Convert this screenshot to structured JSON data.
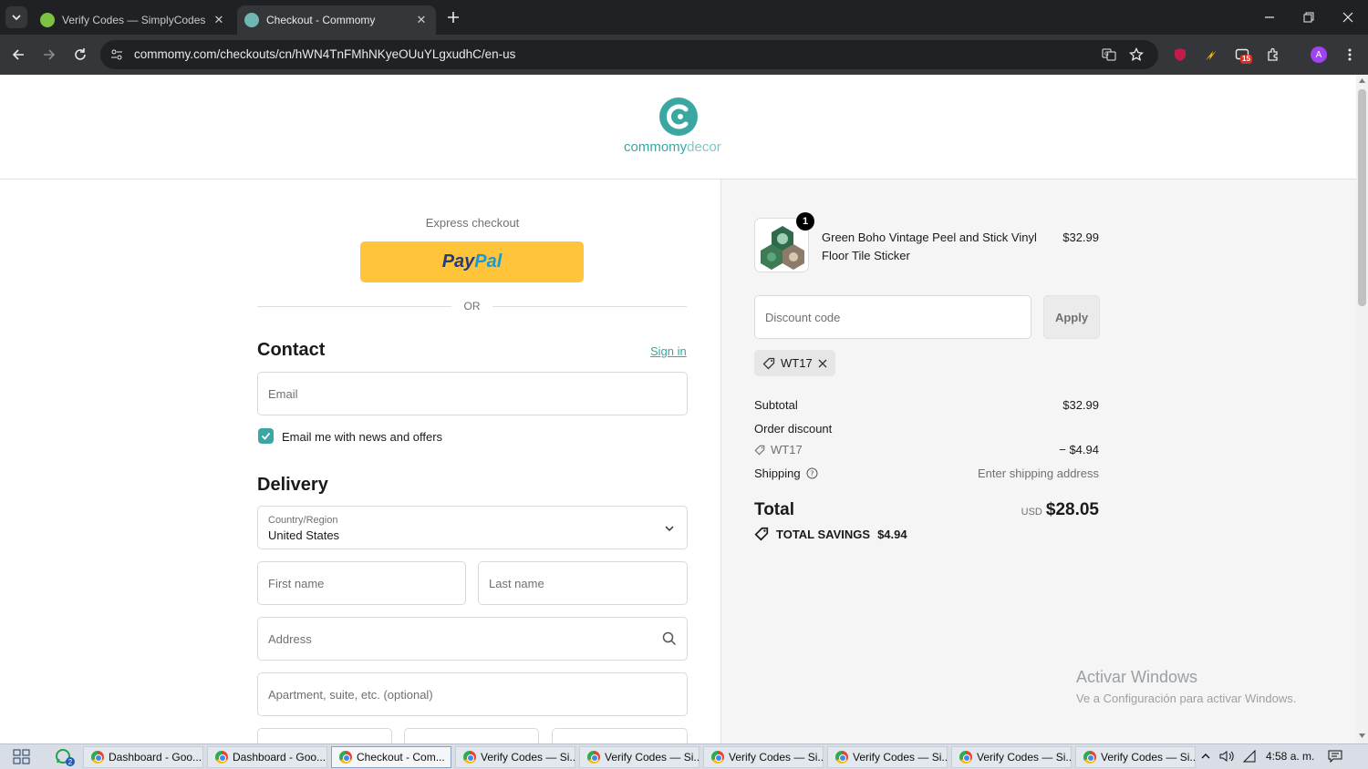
{
  "browser": {
    "tabs": [
      {
        "title": "Verify Codes — SimplyCodes",
        "active": false
      },
      {
        "title": "Checkout - Commomy",
        "active": true
      }
    ],
    "url": "commomy.com/checkouts/cn/hWN4TnFMhNKyeOUuYLgxudhC/en-us",
    "extension_badge": "15",
    "profile_initial": "A"
  },
  "header": {
    "logo_text_a": "commomy",
    "logo_text_b": "decor"
  },
  "checkout": {
    "express_label": "Express checkout",
    "paypal_a": "Pay",
    "paypal_b": "Pal",
    "or_label": "OR",
    "contact_title": "Contact",
    "sign_in": "Sign in",
    "email_placeholder": "Email",
    "newsletter_label": "Email me with news and offers",
    "delivery_title": "Delivery",
    "country_label": "Country/Region",
    "country_value": "United States",
    "first_name_placeholder": "First name",
    "last_name_placeholder": "Last name",
    "address_placeholder": "Address",
    "apartment_placeholder": "Apartment, suite, etc. (optional)"
  },
  "summary": {
    "product": {
      "name_line1": "Green Boho Vintage Peel and Stick Vinyl",
      "name_line2": "Floor Tile Sticker",
      "price": "$32.99",
      "quantity": "1"
    },
    "discount_placeholder": "Discount code",
    "apply_label": "Apply",
    "applied_code": "WT17",
    "subtotal_label": "Subtotal",
    "subtotal_value": "$32.99",
    "order_discount_label": "Order discount",
    "discount_code": "WT17",
    "discount_value": "− $4.94",
    "shipping_label": "Shipping",
    "shipping_value": "Enter shipping address",
    "total_label": "Total",
    "currency": "USD",
    "total_value": "$28.05",
    "savings_label": "TOTAL SAVINGS",
    "savings_value": "$4.94"
  },
  "watermark": {
    "line1": "Activar Windows",
    "line2": "Ve a Configuración para activar Windows."
  },
  "taskbar": {
    "items": [
      {
        "label": "Dashboard - Goo...",
        "active": false
      },
      {
        "label": "Dashboard - Goo...",
        "active": false
      },
      {
        "label": "Checkout - Com...",
        "active": true
      },
      {
        "label": "Verify Codes — Si...",
        "active": false
      },
      {
        "label": "Verify Codes — Si...",
        "active": false
      },
      {
        "label": "Verify Codes — Si...",
        "active": false
      },
      {
        "label": "Verify Codes — Si...",
        "active": false
      },
      {
        "label": "Verify Codes — Si...",
        "active": false
      },
      {
        "label": "Verify Codes — Si...",
        "active": false
      }
    ],
    "whatsapp_badge": "2",
    "clock": "4:58 a. m."
  },
  "colors": {
    "accent": "#3aa7a3",
    "paypal_yellow": "#ffc439",
    "paypal_dark": "#253b80",
    "paypal_light": "#179bd7"
  }
}
